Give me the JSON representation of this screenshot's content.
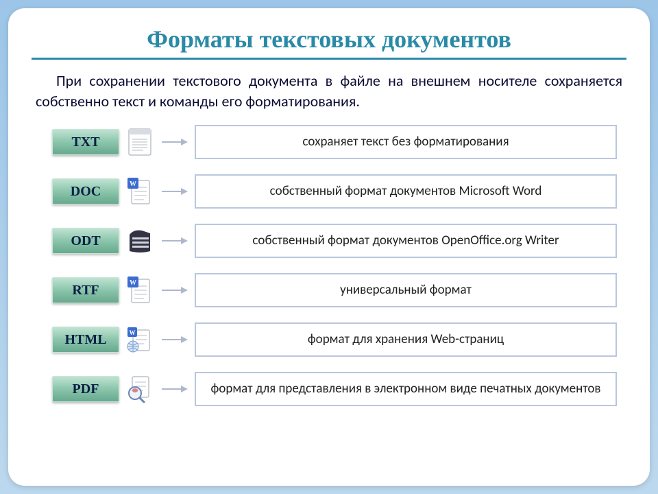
{
  "title": "Форматы текстовых документов",
  "intro": "При сохранении текстового документа в файле на внешнем носителе сохраняется собственно текст и команды его форматирования.",
  "rows": [
    {
      "tag": "TXT",
      "icon": "txt",
      "desc": "сохраняет текст без форматирования"
    },
    {
      "tag": "DOC",
      "icon": "doc",
      "desc": "собственный формат документов Microsoft Word"
    },
    {
      "tag": "ODT",
      "icon": "odt",
      "desc": "собственный формат документов OpenOffice.org Writer"
    },
    {
      "tag": "RTF",
      "icon": "rtf",
      "desc": "универсальный формат"
    },
    {
      "tag": "HTML",
      "icon": "html",
      "desc": "формат для хранения Web-страниц"
    },
    {
      "tag": "PDF",
      "icon": "pdf",
      "desc": "формат для представления в электронном виде печатных документов"
    }
  ]
}
